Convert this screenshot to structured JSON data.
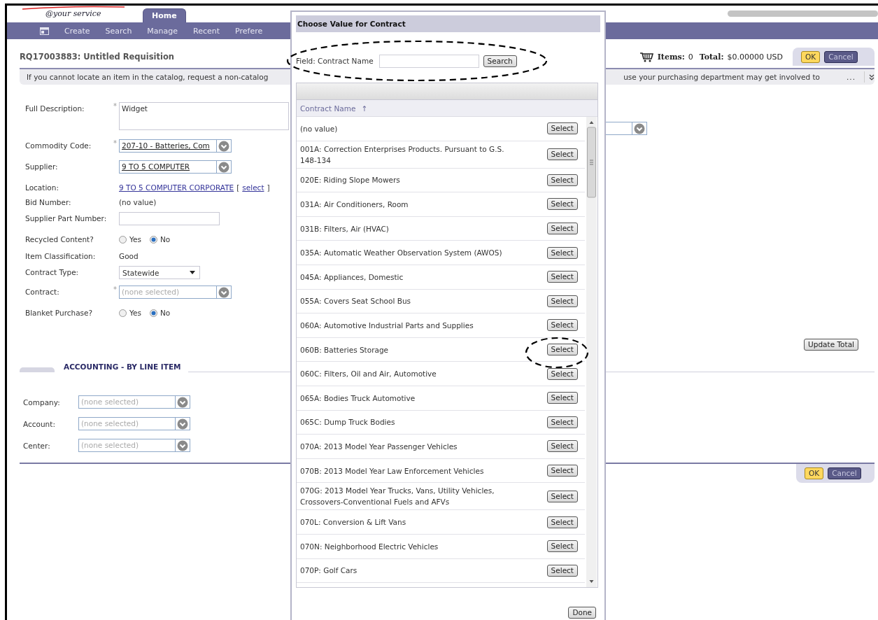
{
  "header": {
    "tagline": "@your service",
    "tabs": [
      {
        "label": "Home",
        "selected": true
      }
    ],
    "nav": [
      "Create",
      "Search",
      "Manage",
      "Recent",
      "Prefere"
    ]
  },
  "requisition": {
    "title": "RQ17003883: Untitled Requisition",
    "items_label": "Items:",
    "items": "0",
    "total_label": "Total:",
    "total": "$0.00000 USD",
    "buttons": [
      "OK",
      "Cancel"
    ]
  },
  "notice": {
    "text_start": "If you cannot locate an item in the catalog, request a non-catalog",
    "text_end": "use your purchasing department may get involved to",
    "more": "..."
  },
  "required_mark": "*",
  "form": {
    "fields": [
      {
        "kind": "textarea",
        "label": "Full Description:",
        "required": true,
        "value": "Widget"
      },
      {
        "kind": "combo",
        "label": "Commodity Code:",
        "required": true,
        "value": "207-10 - Batteries, Com"
      },
      {
        "kind": "combo",
        "label": "Supplier:",
        "required": false,
        "value": "9 TO 5 COMPUTER"
      },
      {
        "kind": "link",
        "label": "Location:",
        "required": false,
        "value": "9 TO 5 COMPUTER CORPORATE",
        "action_open": "[",
        "action": "select",
        "action_close": "]"
      },
      {
        "kind": "text",
        "label": "Bid Number:",
        "required": false,
        "value": "(no value)"
      },
      {
        "kind": "input",
        "label": "Supplier Part Number:",
        "required": false
      },
      {
        "kind": "radio",
        "label": "Recycled Content?",
        "required": false,
        "options": [
          {
            "label": "Yes",
            "selected": false
          },
          {
            "label": "No",
            "selected": true
          }
        ]
      },
      {
        "kind": "text",
        "label": "Item Classification:",
        "required": false,
        "value": "Good"
      },
      {
        "kind": "select",
        "label": "Contract Type:",
        "required": false,
        "value": "Statewide"
      },
      {
        "kind": "combo",
        "label": "Contract:",
        "required": true,
        "placeholder": "(none selected)"
      },
      {
        "kind": "radio",
        "label": "Blanket Purchase?",
        "required": false,
        "options": [
          {
            "label": "Yes",
            "selected": false
          },
          {
            "label": "No",
            "selected": true
          }
        ]
      }
    ]
  },
  "update_button": "Update Total",
  "accounting": {
    "title": "ACCOUNTING - BY LINE ITEM",
    "fields": [
      {
        "label": "Company:",
        "placeholder": "(none selected)"
      },
      {
        "label": "Account:",
        "placeholder": "(none selected)"
      },
      {
        "label": "Center:",
        "placeholder": "(none selected)"
      }
    ]
  },
  "footer_buttons": [
    "OK",
    "Cancel"
  ],
  "dialog": {
    "title": "Choose Value for Contract",
    "search_label": "Field: Contract Name",
    "search_button": "Search",
    "column": "Contract Name",
    "sort": "↑",
    "rows": [
      {
        "name": "(no value)",
        "action": "Select"
      },
      {
        "name": "001A: Correction Enterprises Products. Pursuant to G.S. 148-134",
        "action": "Select"
      },
      {
        "name": "020E: Riding Slope Mowers",
        "action": "Select"
      },
      {
        "name": "031A: Air Conditioners, Room",
        "action": "Select"
      },
      {
        "name": "031B: Filters, Air (HVAC)",
        "action": "Select"
      },
      {
        "name": "035A: Automatic Weather Observation System (AWOS)",
        "action": "Select"
      },
      {
        "name": "045A: Appliances, Domestic",
        "action": "Select"
      },
      {
        "name": "055A: Covers Seat School Bus",
        "action": "Select"
      },
      {
        "name": "060A: Automotive Industrial Parts and Supplies",
        "action": "Select"
      },
      {
        "name": "060B: Batteries Storage",
        "action": "Select"
      },
      {
        "name": "060C: Filters, Oil and Air, Automotive",
        "action": "Select"
      },
      {
        "name": "065A: Bodies Truck Automotive",
        "action": "Select"
      },
      {
        "name": "065C: Dump Truck Bodies",
        "action": "Select"
      },
      {
        "name": "070A: 2013 Model Year Passenger Vehicles",
        "action": "Select"
      },
      {
        "name": "070B: 2013 Model Year Law Enforcement Vehicles",
        "action": "Select"
      },
      {
        "name": "070G: 2013 Model Year Trucks, Vans, Utility Vehicles, Crossovers-Conventional Fuels and AFVs",
        "action": "Select"
      },
      {
        "name": "070L: Conversion & Lift Vans",
        "action": "Select"
      },
      {
        "name": "070N: Neighborhood Electric Vehicles",
        "action": "Select"
      },
      {
        "name": "070P: Golf Cars",
        "action": "Select"
      }
    ],
    "done_button": "Done"
  }
}
